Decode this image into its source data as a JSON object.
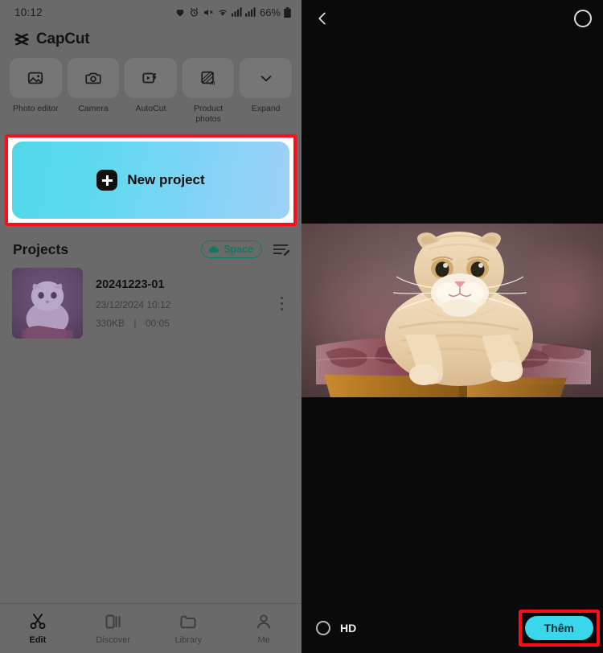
{
  "left_panel": {
    "statusbar": {
      "time": "10:12",
      "battery_pct": "66%",
      "icons": [
        "heart-icon",
        "alarm-icon",
        "mute-icon",
        "wifi-icon",
        "signal-icon",
        "signal-icon",
        "battery-icon"
      ]
    },
    "brand": {
      "name": "CapCut",
      "logo": "capcut-logo-icon"
    },
    "toolbar": [
      {
        "label": "Photo editor",
        "icon": "photo-editor-icon"
      },
      {
        "label": "Camera",
        "icon": "camera-icon"
      },
      {
        "label": "AutoCut",
        "icon": "autocut-icon"
      },
      {
        "label": "Product photos",
        "icon": "product-photos-ai-icon"
      },
      {
        "label": "Expand",
        "icon": "chevron-down-icon"
      }
    ],
    "new_project": {
      "label": "New project",
      "icon": "plus-icon",
      "highlight_color": "#fc0d1b"
    },
    "projects_section": {
      "title": "Projects",
      "space_chip": {
        "label": "Space",
        "icon": "cloud-icon",
        "color": "#0f7a63"
      },
      "sort_icon": "sort-edit-icon",
      "items": [
        {
          "name": "20241223-01",
          "date": "23/12/2024 10:12",
          "size": "330KB",
          "separator": "|",
          "duration": "00:05",
          "menu_icon": "more-vertical-icon",
          "thumbnail": "cat-thumbnail"
        }
      ]
    },
    "bottom_nav": [
      {
        "label": "Edit",
        "icon": "scissors-icon",
        "active": true
      },
      {
        "label": "Discover",
        "icon": "discover-icon",
        "active": false
      },
      {
        "label": "Library",
        "icon": "folder-icon",
        "active": false
      },
      {
        "label": "Me",
        "icon": "person-icon",
        "active": false
      }
    ]
  },
  "right_panel": {
    "header": {
      "back_icon": "back-chevron-icon",
      "select_icon": "select-circle-icon"
    },
    "preview": {
      "image": "cat-photo",
      "description": "Scottish Fold cat on cushioned stool"
    },
    "footer": {
      "hd_label": "HD",
      "hd_icon": "radio-unchecked-icon",
      "add_button": {
        "label": "Thêm",
        "color": "#3ad6ec",
        "highlight_color": "#fc0d1b"
      }
    }
  }
}
